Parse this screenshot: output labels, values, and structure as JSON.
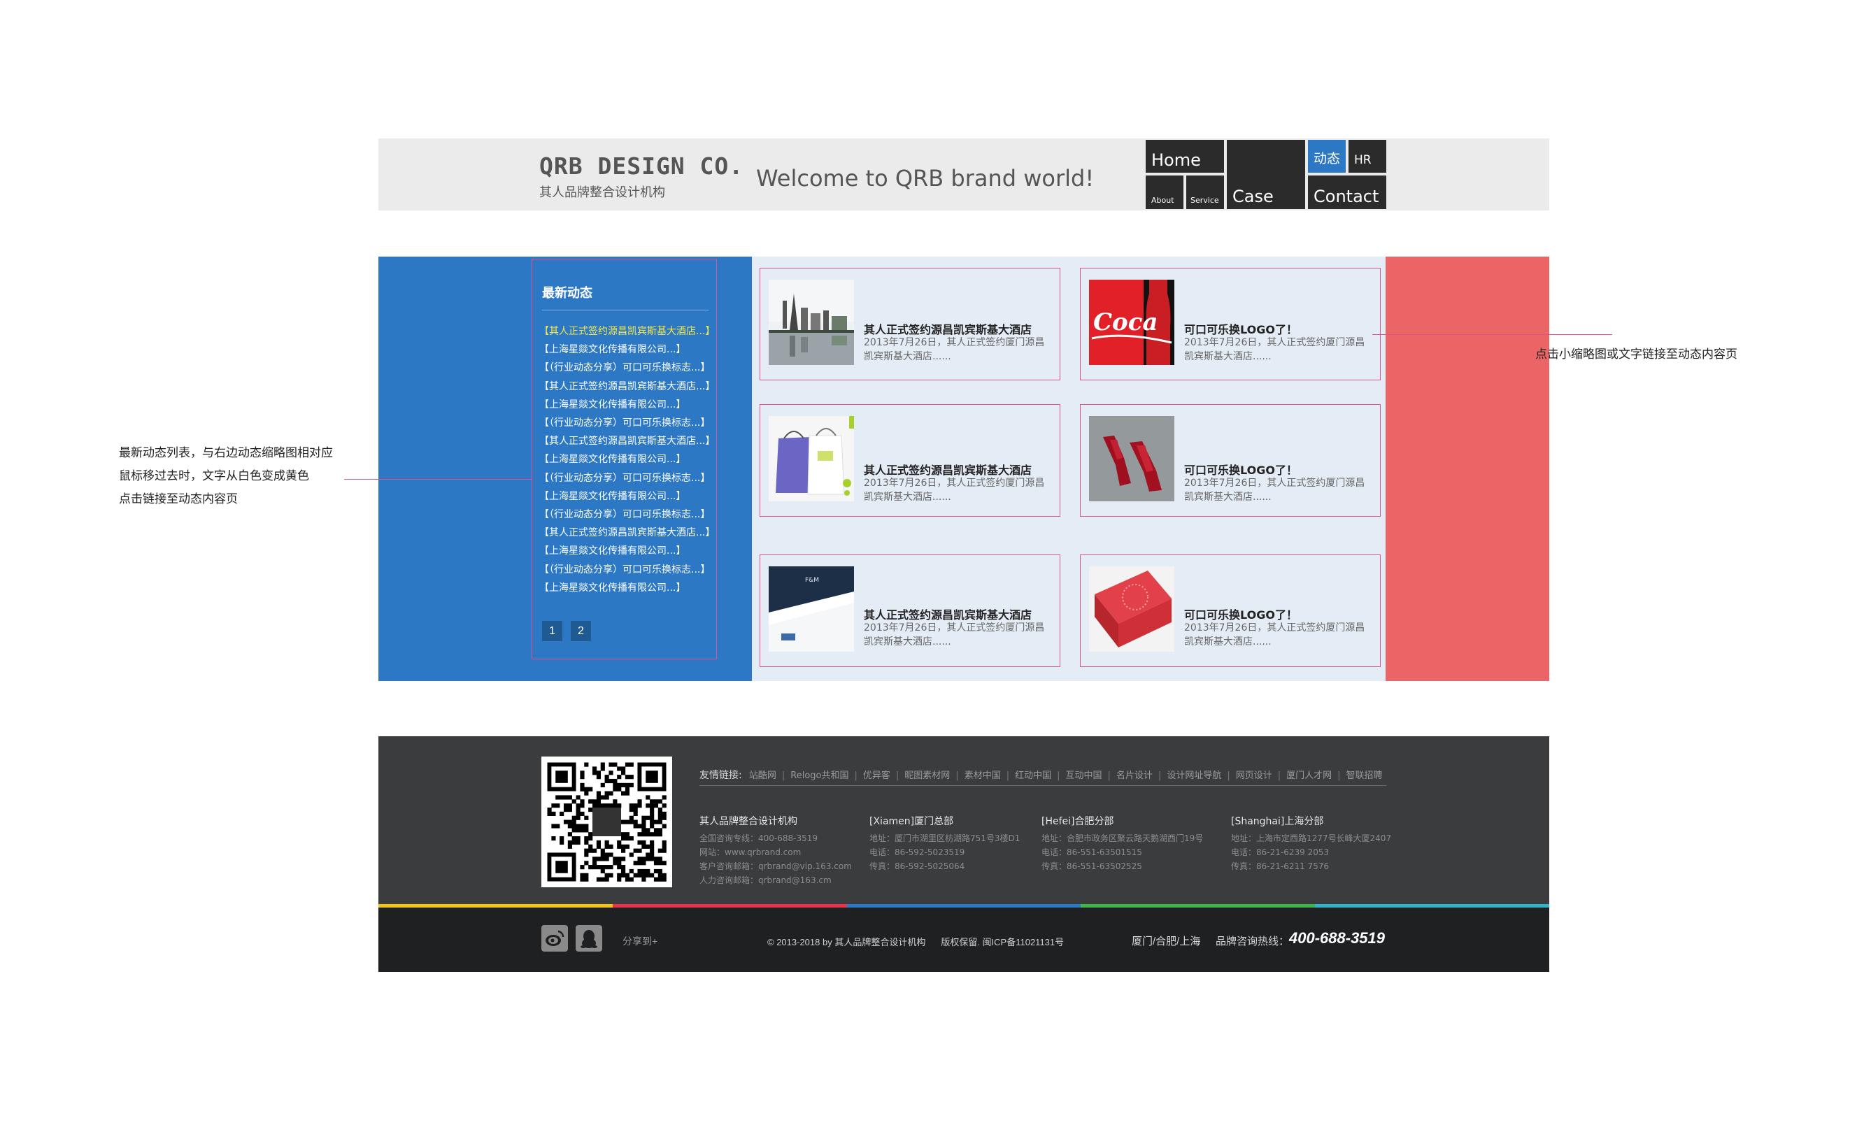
{
  "header": {
    "logo_main": "QRB DESIGN CO.",
    "logo_sub": "其人品牌整合设计机构",
    "welcome": "Welcome to QRB brand world!",
    "nav": {
      "home": "Home",
      "about": "About",
      "service": "Service",
      "case": "Case",
      "news": "动态",
      "hr": "HR",
      "contact": "Contact"
    }
  },
  "news": {
    "title": "最新动态",
    "items": [
      "【其人正式签约源昌凯宾斯基大酒店...】",
      "【上海星燚文化传播有限公司...】",
      "【（行业动态分享）可口可乐换标志...】",
      "【其人正式签约源昌凯宾斯基大酒店...】",
      "【上海星燚文化传播有限公司...】",
      "【（行业动态分享）可口可乐换标志...】",
      "【其人正式签约源昌凯宾斯基大酒店...】",
      "【上海星燚文化传播有限公司...】",
      "【（行业动态分享）可口可乐换标志...】",
      "【上海星燚文化传播有限公司...】",
      "【（行业动态分享）可口可乐换标志...】",
      "【其人正式签约源昌凯宾斯基大酒店...】",
      "【上海星燚文化传播有限公司...】",
      "【（行业动态分享）可口可乐换标志...】",
      "【上海星燚文化传播有限公司...】"
    ],
    "pages": [
      "1",
      "2"
    ]
  },
  "cards": [
    {
      "title": "其人正式签约源昌凯宾斯基大酒店",
      "desc": "2013年7月26日，其人正式签约厦门源昌凯宾斯基大酒店......",
      "thumb": "city-skyline"
    },
    {
      "title": "可口可乐换LOGO了！",
      "desc": "2013年7月26日，其人正式签约厦门源昌凯宾斯基大酒店......",
      "thumb": "coca-cola"
    },
    {
      "title": "其人正式签约源昌凯宾斯基大酒店",
      "desc": "2013年7月26日，其人正式签约厦门源昌凯宾斯基大酒店......",
      "thumb": "shopping-bags"
    },
    {
      "title": "可口可乐换LOGO了！",
      "desc": "2013年7月26日，其人正式签约厦门源昌凯宾斯基大酒店......",
      "thumb": "red-shoes"
    },
    {
      "title": "其人正式签约源昌凯宾斯基大酒店",
      "desc": "2013年7月26日，其人正式签约厦门源昌凯宾斯基大酒店......",
      "thumb": "business-cards"
    },
    {
      "title": "可口可乐换LOGO了！",
      "desc": "2013年7月26日，其人正式签约厦门源昌凯宾斯基大酒店......",
      "thumb": "red-box"
    }
  ],
  "annotations": {
    "left": [
      "最新动态列表，与右边动态缩略图相对应",
      "鼠标移过去时，文字从白色变成黄色",
      "点击链接至动态内容页"
    ],
    "right": "点击小缩略图或文字链接至动态内容页"
  },
  "footer": {
    "links_label": "友情链接:",
    "links": [
      "站酷网",
      "Relogo共和国",
      "优异客",
      "昵图素材网",
      "素材中国",
      "红动中国",
      "互动中国",
      "名片设计",
      "设计网址导航",
      "网页设计",
      "厦门人才网",
      "智联招聘"
    ],
    "offices": [
      {
        "name": "其人品牌整合设计机构",
        "lines": [
          "全国咨询专线：400-688-3519",
          "网站：www.qrbrand.com",
          "客户咨询邮箱：qrbrand@vip.163.com",
          "人力咨询邮箱：qrbrand@163.cm"
        ]
      },
      {
        "name": "[Xiamen]厦门总部",
        "lines": [
          "地址：厦门市湖里区枋湖路751号3楼D1",
          "电话：86-592-5023519",
          "传真：86-592-5025064"
        ]
      },
      {
        "name": "[Hefei]合肥分部",
        "lines": [
          "地址：合肥市政务区聚云路天鹅湖西门19号",
          "电话：86-551-63501515",
          "传真：86-551-63502525"
        ]
      },
      {
        "name": "[Shanghai]上海分部",
        "lines": [
          "地址：上海市定西路1277号长峰大厦2407",
          "电话：86-21-6239 2053",
          "传真：86-21-6211 7576"
        ]
      }
    ],
    "share": "分享到+",
    "copyright": "© 2013-2018 by 其人品牌整合设计机构",
    "icp": "版权保留. 闽ICP备11021131号",
    "cities": "厦门/合肥/上海",
    "hotline_label": "品牌咨询热线：",
    "hotline": "400-688-3519",
    "stripe_colors": [
      "#f0c419",
      "#e8344c",
      "#2d78c4",
      "#3db54a",
      "#2eb5c8"
    ]
  },
  "colors": {
    "accent_blue": "#2d78c4",
    "accent_red": "#ec6566",
    "highlight_yellow": "#f5e94a",
    "annotation_pink": "#e0518f"
  }
}
